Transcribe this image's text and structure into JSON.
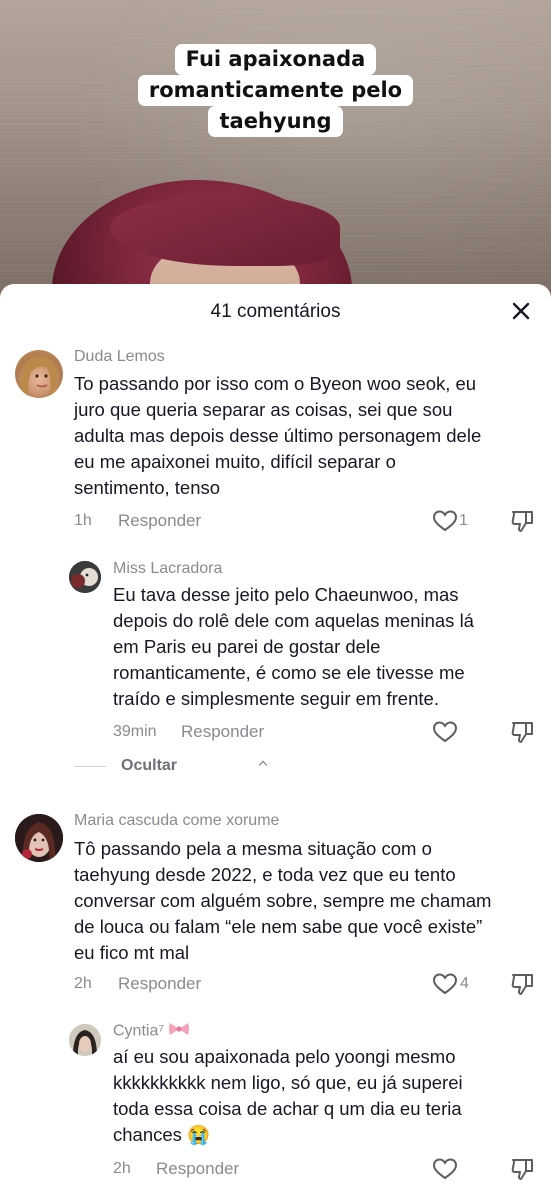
{
  "video": {
    "caption_lines": [
      "Fui apaixonada",
      "romanticamente pelo",
      "taehyung"
    ]
  },
  "comments_sheet": {
    "title": "41 comentários",
    "hide_replies_label": "Ocultar",
    "comments": [
      {
        "username": "Duda Lemos",
        "text_lines": [
          "To passando por isso com o Byeon woo seok, eu",
          "juro que queria separar as coisas, sei que sou",
          "adulta mas depois desse último personagem dele",
          "eu me apaixonei muito, difícil separar o",
          "sentimento, tenso"
        ],
        "time": "1h",
        "reply_label": "Responder",
        "likes": "1"
      },
      {
        "username": "Miss Lacradora",
        "text_lines": [
          "Eu tava desse jeito pelo Chaeunwoo, mas",
          "depois do rolê dele com aquelas meninas lá",
          "em Paris eu parei de gostar dele",
          "romanticamente, é como se ele tivesse me",
          "traído e simplesmente seguir em frente."
        ],
        "time": "39min",
        "reply_label": "Responder",
        "likes": ""
      },
      {
        "username": "Maria cascuda come xorume",
        "text_lines": [
          "Tô passando pela a mesma situação com o",
          "taehyung desde 2022, e toda vez que eu tento",
          "conversar com alguém sobre, sempre me chamam",
          "de louca ou falam “ele nem sabe que você existe”",
          "eu fico mt mal"
        ],
        "time": "2h",
        "reply_label": "Responder",
        "likes": "4"
      },
      {
        "username": "Cyntia⁷",
        "text_lines": [
          "aí eu sou apaixonada pelo yoongi mesmo",
          "kkkkkkkkkk nem ligo, só que, eu já superei",
          "toda essa coisa de achar q um dia eu teria",
          "chances 😭"
        ],
        "time": "2h",
        "reply_label": "Responder",
        "likes": ""
      }
    ]
  },
  "icons": {
    "close": "close-icon",
    "like": "heart-outline-icon",
    "dislike": "thumbs-down-outline-icon",
    "ribbon": "ribbon-emoji-icon"
  },
  "colors": {
    "username": "#8a8b91",
    "body_text": "#161823",
    "hair": "#7a2439"
  }
}
